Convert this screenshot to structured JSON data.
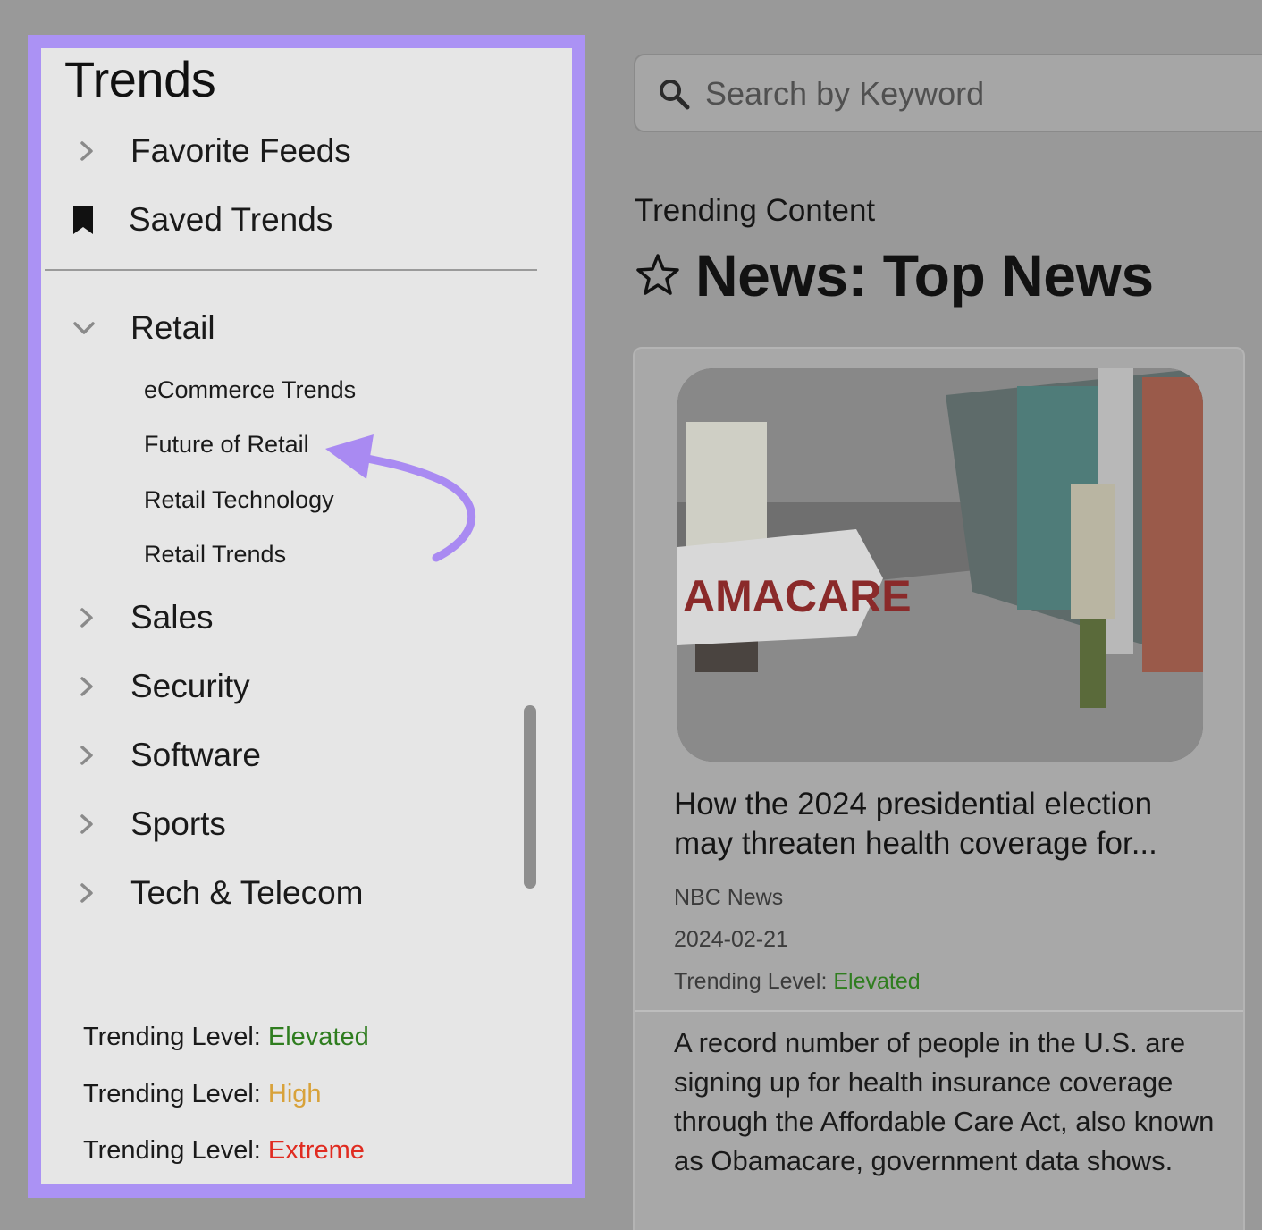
{
  "sidebar": {
    "title": "Trends",
    "top_items": [
      {
        "label": "Favorite Feeds",
        "icon": "chevron-right-icon"
      },
      {
        "label": "Saved Trends",
        "icon": "bookmark-icon"
      }
    ],
    "retail": {
      "label": "Retail",
      "icon": "chevron-down-icon",
      "subitems": [
        "eCommerce Trends",
        "Future of Retail",
        "Retail Technology",
        "Retail Trends"
      ]
    },
    "categories": [
      {
        "label": "Sales"
      },
      {
        "label": "Security"
      },
      {
        "label": "Software"
      },
      {
        "label": "Sports"
      },
      {
        "label": "Tech & Telecom"
      }
    ],
    "legend": [
      {
        "prefix": "Trending Level: ",
        "level": "Elevated",
        "color": "#2f7d1f"
      },
      {
        "prefix": "Trending Level: ",
        "level": "High",
        "color": "#d8a23a"
      },
      {
        "prefix": "Trending Level: ",
        "level": "Extreme",
        "color": "#e02c21"
      }
    ],
    "highlight_color": "#ab92f4"
  },
  "search": {
    "placeholder": "Search by Keyword",
    "icon": "search-icon"
  },
  "main": {
    "section_label": "Trending Content",
    "title": "News: Top News",
    "title_icon": "star-outline-icon"
  },
  "card": {
    "image_alt": "AMACARE",
    "headline": "How the 2024 presidential election may threaten health coverage for...",
    "source": "NBC News",
    "date": "2024-02-21",
    "level_prefix": "Trending Level: ",
    "level": "Elevated",
    "summary": "A record number of people in the U.S. are signing up for health insurance coverage through the Affordable Care Act, also known as Obamacare, government data shows."
  }
}
